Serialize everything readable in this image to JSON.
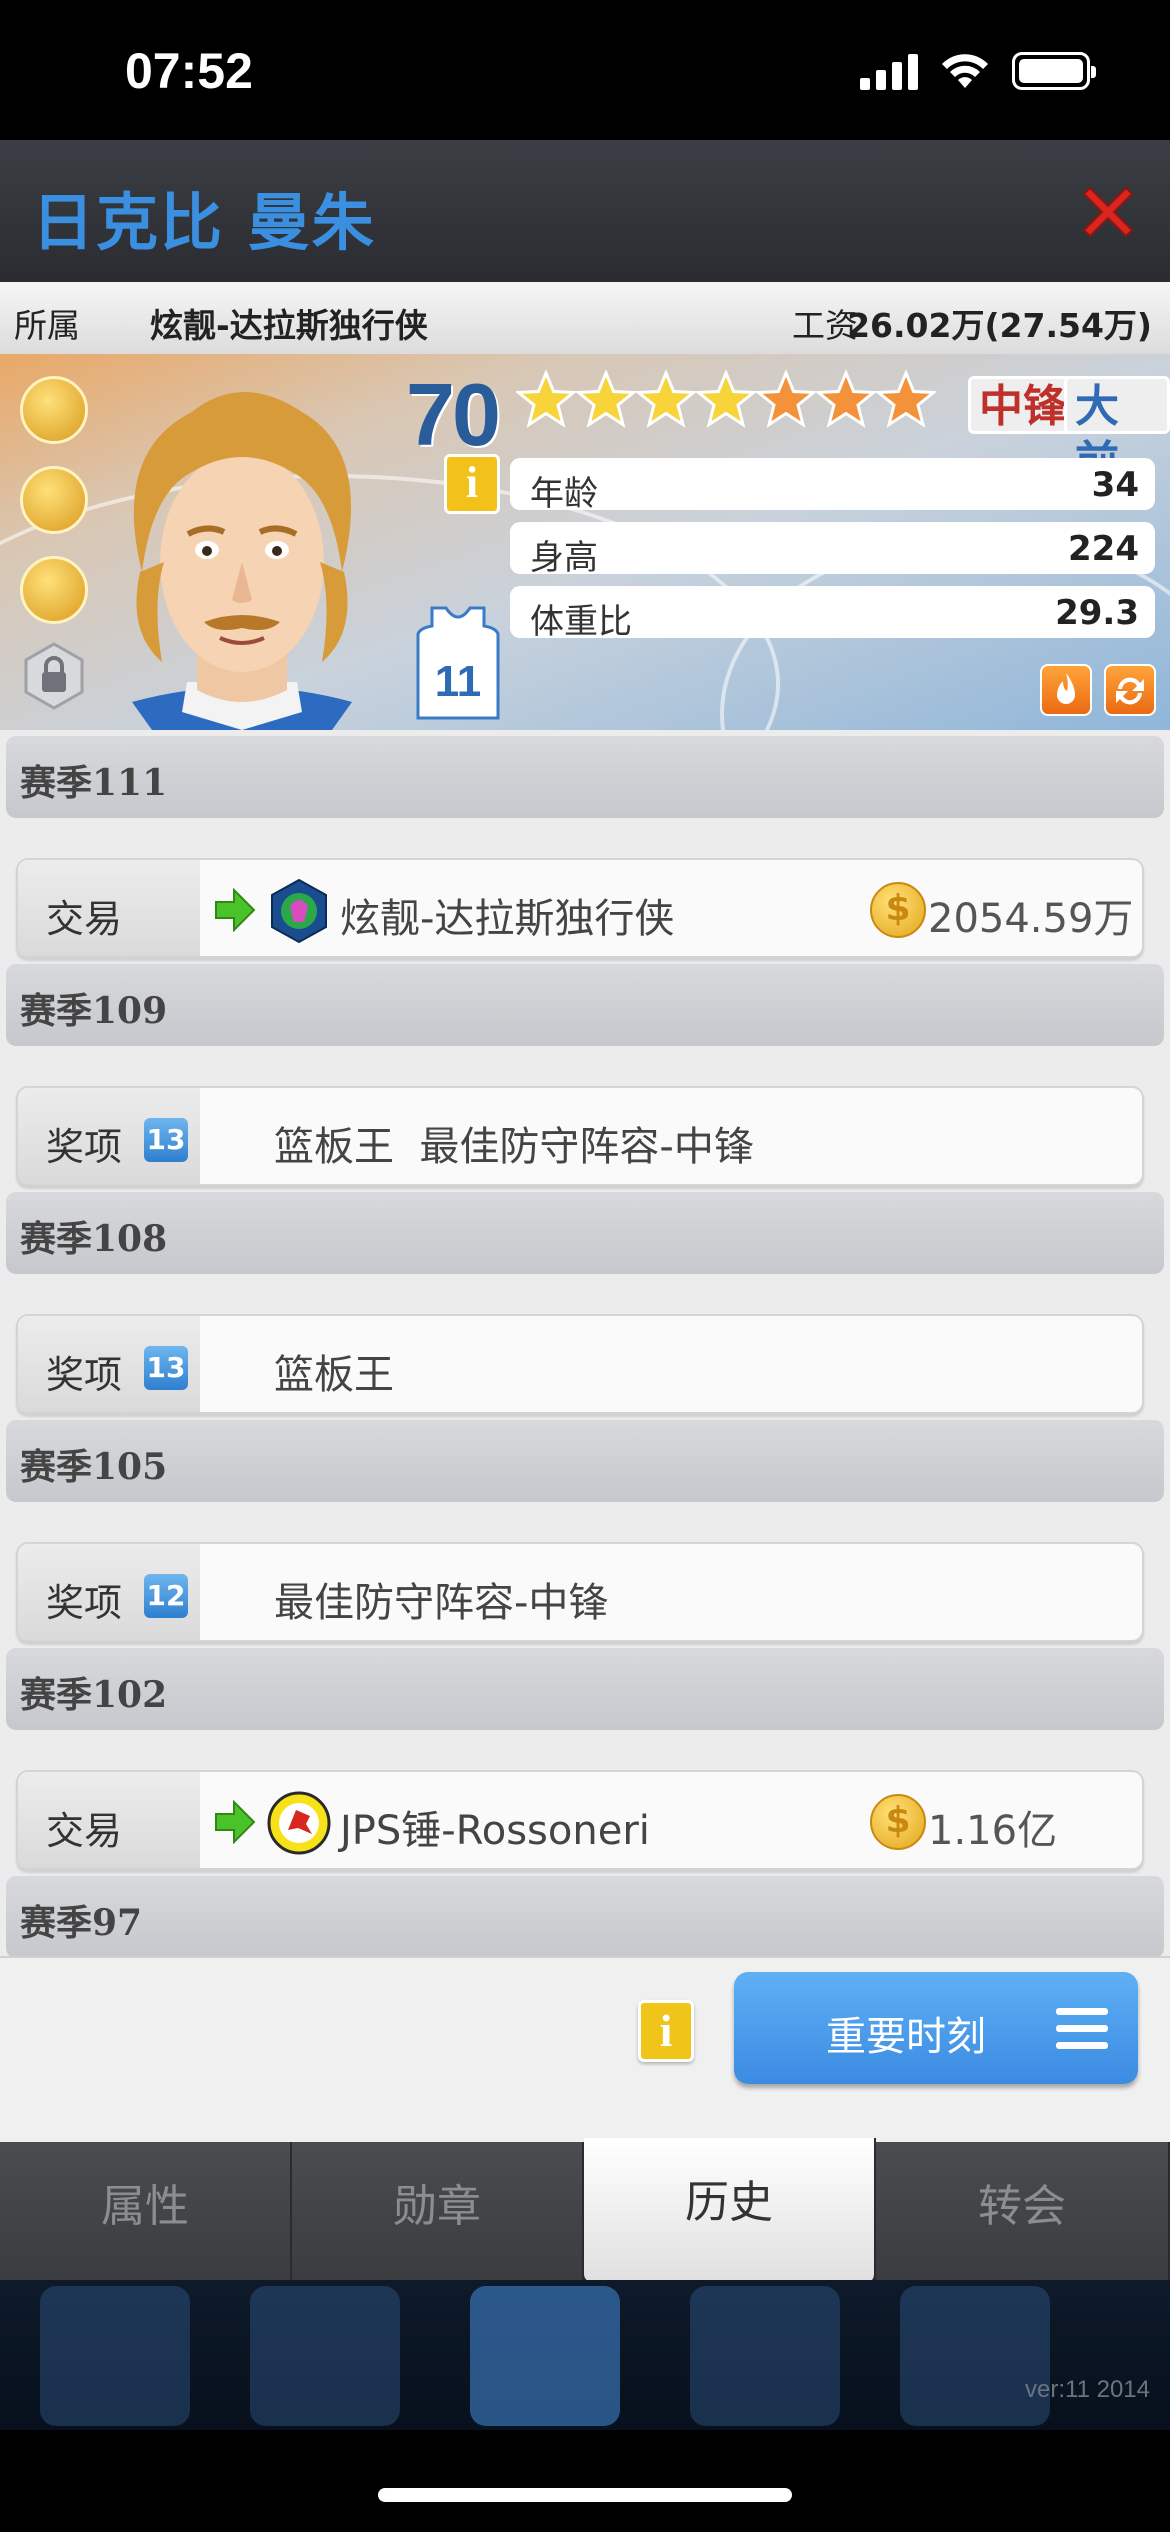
{
  "status_bar": {
    "time": "07:52"
  },
  "title_bar": {
    "player_name": "日克比 曼朱"
  },
  "team_bar": {
    "team_label": "所属",
    "team_name": "炫靓-达拉斯独行侠",
    "salary_label": "工资",
    "salary_value": "26.02万(27.54万)"
  },
  "player_card": {
    "rating": "70",
    "stars_total": 7,
    "stars_gold": 4,
    "positions": [
      "中锋",
      "大前"
    ],
    "jersey_number": "11",
    "info_glyph": "i",
    "stats": [
      {
        "label": "年龄",
        "value": "34"
      },
      {
        "label": "身高",
        "value": "224"
      },
      {
        "label": "体重比",
        "value": "29.3"
      }
    ]
  },
  "history": {
    "seasons": [
      {
        "title": "赛季111",
        "entries": [
          {
            "type": "交易",
            "team": "炫靓-达拉斯独行侠",
            "amount": "2054.59万"
          }
        ]
      },
      {
        "title": "赛季109",
        "entries": [
          {
            "type": "奖项",
            "badge": "13",
            "text": "篮板王  最佳防守阵容-中锋"
          }
        ]
      },
      {
        "title": "赛季108",
        "entries": [
          {
            "type": "奖项",
            "badge": "13",
            "text": "篮板王"
          }
        ]
      },
      {
        "title": "赛季105",
        "entries": [
          {
            "type": "奖项",
            "badge": "12",
            "text": "最佳防守阵容-中锋"
          }
        ]
      },
      {
        "title": "赛季102",
        "entries": [
          {
            "type": "交易",
            "team": "JPS锤-Rossoneri",
            "amount": "1.16亿"
          }
        ]
      },
      {
        "title": "赛季97",
        "entries": []
      }
    ]
  },
  "action_panel": {
    "info_glyph": "i",
    "moments_button": "重要时刻"
  },
  "tabs": [
    {
      "label": "属性",
      "active": false
    },
    {
      "label": "勋章",
      "active": false
    },
    {
      "label": "历史",
      "active": true
    },
    {
      "label": "转会",
      "active": false
    }
  ],
  "footer": {
    "version": "ver:11  2014"
  },
  "colors": {
    "accent_blue": "#3a8fe0",
    "center_red": "#c0302b",
    "forward_blue": "#2f6bb5",
    "coin_gold": "#e4a417"
  }
}
